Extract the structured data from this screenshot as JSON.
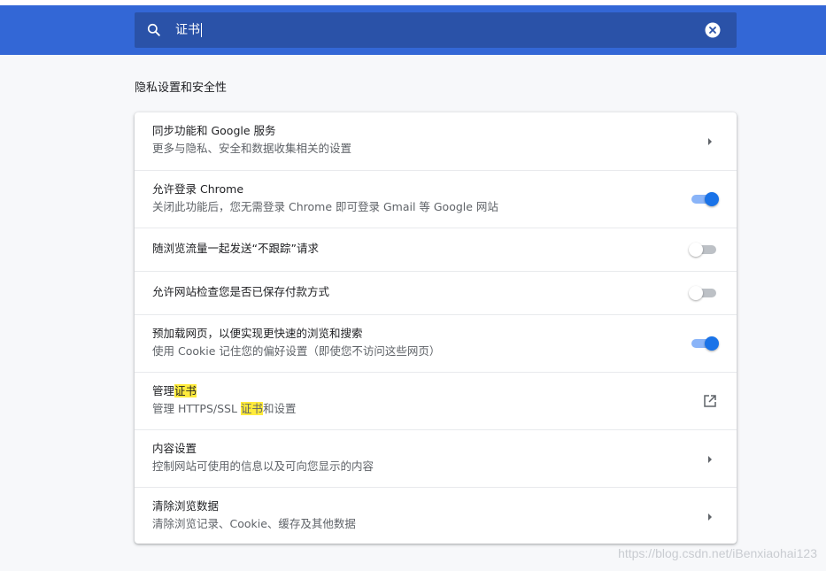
{
  "search": {
    "query": "证书"
  },
  "section": {
    "title": "隐私设置和安全性"
  },
  "rows": [
    {
      "title": "同步功能和 Google 服务",
      "subtitle": "更多与隐私、安全和数据收集相关的设置",
      "control": "chevron"
    },
    {
      "title": "允许登录 Chrome",
      "subtitle": "关闭此功能后，您无需登录 Chrome 即可登录 Gmail 等 Google 网站",
      "control": "toggle",
      "enabled": true
    },
    {
      "title": "随浏览流量一起发送“不跟踪”请求",
      "control": "toggle",
      "enabled": false
    },
    {
      "title": "允许网站检查您是否已保存付款方式",
      "control": "toggle",
      "enabled": false
    },
    {
      "title": "预加载网页，以便实现更快速的浏览和搜索",
      "subtitle": "使用 Cookie 记住您的偏好设置（即使您不访问这些网页）",
      "control": "toggle",
      "enabled": true
    },
    {
      "title_prefix": "管理",
      "title_highlight": "证书",
      "subtitle_prefix": "管理 HTTPS/SSL ",
      "subtitle_highlight": "证书",
      "subtitle_suffix": "和设置",
      "control": "external-link"
    },
    {
      "title": "内容设置",
      "subtitle": "控制网站可使用的信息以及可向您显示的内容",
      "control": "chevron"
    },
    {
      "title": "清除浏览数据",
      "subtitle": "清除浏览记录、Cookie、缓存及其他数据",
      "control": "chevron"
    }
  ],
  "watermark": "https://blog.csdn.net/iBenxiaohai123",
  "colors": {
    "header": "#3367d6",
    "search_box": "#2a52a8",
    "toggle_on": "#1a73e8",
    "highlight": "#ffeb3b"
  }
}
